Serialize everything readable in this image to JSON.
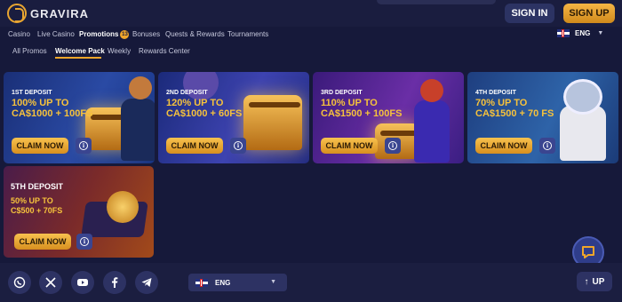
{
  "header": {
    "logo_text": "GRAVIRA",
    "signin_label": "SIGN IN",
    "signup_label": "SIGN UP"
  },
  "nav": {
    "items": [
      "Casino",
      "Live Casino",
      "Promotions",
      "Bonuses",
      "Quests & Rewards",
      "Tournaments"
    ],
    "active": "Promotions",
    "promotions_badge": "13",
    "language": "ENG"
  },
  "subnav": {
    "items": [
      "All Promos",
      "Welcome Pack",
      "Weekly",
      "Rewards Center"
    ],
    "active": "Welcome Pack"
  },
  "cards": [
    {
      "deposit": "1ST DEPOSIT",
      "line1": "100% UP TO",
      "line2": "CA$1000 + 100FS",
      "claim": "CLAIM NOW",
      "info": "i"
    },
    {
      "deposit": "2ND DEPOSIT",
      "line1": "120% UP TO",
      "line2": "CA$1000 + 60FS",
      "claim": "CLAIM NOW",
      "info": "i"
    },
    {
      "deposit": "3RD DEPOSIT",
      "line1": "110% UP TO",
      "line2": "CA$1500 + 100FS",
      "claim": "CLAIM NOW",
      "info": "i"
    },
    {
      "deposit": "4TH DEPOSIT",
      "line1": "70% UP TO",
      "line2": "CA$1500 + 70 FS",
      "claim": "CLAIM NOW",
      "info": "i"
    },
    {
      "deposit": "5TH DEPOSIT",
      "line1": "50% UP TO",
      "line2": "C$500 + 70FS",
      "claim": "CLAIM NOW",
      "info": "i"
    }
  ],
  "footer": {
    "social_icons": [
      "whatsapp-icon",
      "x-icon",
      "youtube-icon",
      "facebook-icon",
      "telegram-icon"
    ],
    "language": "ENG",
    "up_label": "UP"
  },
  "colors": {
    "background": "#16193a",
    "accent": "#f0a62a",
    "gold_text": "#f6c23c"
  }
}
